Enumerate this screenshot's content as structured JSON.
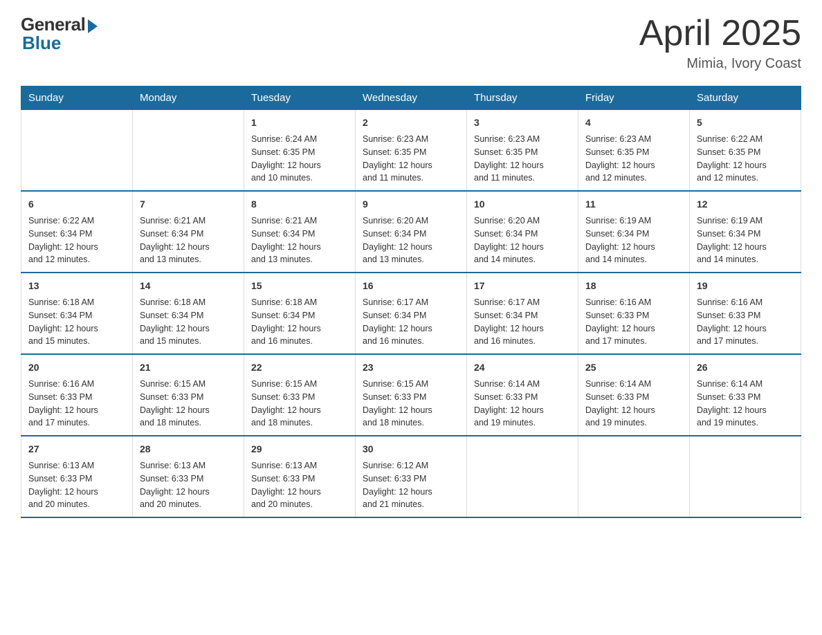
{
  "logo": {
    "general": "General",
    "blue": "Blue"
  },
  "header": {
    "title": "April 2025",
    "subtitle": "Mimia, Ivory Coast"
  },
  "weekdays": [
    "Sunday",
    "Monday",
    "Tuesday",
    "Wednesday",
    "Thursday",
    "Friday",
    "Saturday"
  ],
  "weeks": [
    [
      {
        "day": "",
        "info": ""
      },
      {
        "day": "",
        "info": ""
      },
      {
        "day": "1",
        "info": "Sunrise: 6:24 AM\nSunset: 6:35 PM\nDaylight: 12 hours\nand 10 minutes."
      },
      {
        "day": "2",
        "info": "Sunrise: 6:23 AM\nSunset: 6:35 PM\nDaylight: 12 hours\nand 11 minutes."
      },
      {
        "day": "3",
        "info": "Sunrise: 6:23 AM\nSunset: 6:35 PM\nDaylight: 12 hours\nand 11 minutes."
      },
      {
        "day": "4",
        "info": "Sunrise: 6:23 AM\nSunset: 6:35 PM\nDaylight: 12 hours\nand 12 minutes."
      },
      {
        "day": "5",
        "info": "Sunrise: 6:22 AM\nSunset: 6:35 PM\nDaylight: 12 hours\nand 12 minutes."
      }
    ],
    [
      {
        "day": "6",
        "info": "Sunrise: 6:22 AM\nSunset: 6:34 PM\nDaylight: 12 hours\nand 12 minutes."
      },
      {
        "day": "7",
        "info": "Sunrise: 6:21 AM\nSunset: 6:34 PM\nDaylight: 12 hours\nand 13 minutes."
      },
      {
        "day": "8",
        "info": "Sunrise: 6:21 AM\nSunset: 6:34 PM\nDaylight: 12 hours\nand 13 minutes."
      },
      {
        "day": "9",
        "info": "Sunrise: 6:20 AM\nSunset: 6:34 PM\nDaylight: 12 hours\nand 13 minutes."
      },
      {
        "day": "10",
        "info": "Sunrise: 6:20 AM\nSunset: 6:34 PM\nDaylight: 12 hours\nand 14 minutes."
      },
      {
        "day": "11",
        "info": "Sunrise: 6:19 AM\nSunset: 6:34 PM\nDaylight: 12 hours\nand 14 minutes."
      },
      {
        "day": "12",
        "info": "Sunrise: 6:19 AM\nSunset: 6:34 PM\nDaylight: 12 hours\nand 14 minutes."
      }
    ],
    [
      {
        "day": "13",
        "info": "Sunrise: 6:18 AM\nSunset: 6:34 PM\nDaylight: 12 hours\nand 15 minutes."
      },
      {
        "day": "14",
        "info": "Sunrise: 6:18 AM\nSunset: 6:34 PM\nDaylight: 12 hours\nand 15 minutes."
      },
      {
        "day": "15",
        "info": "Sunrise: 6:18 AM\nSunset: 6:34 PM\nDaylight: 12 hours\nand 16 minutes."
      },
      {
        "day": "16",
        "info": "Sunrise: 6:17 AM\nSunset: 6:34 PM\nDaylight: 12 hours\nand 16 minutes."
      },
      {
        "day": "17",
        "info": "Sunrise: 6:17 AM\nSunset: 6:34 PM\nDaylight: 12 hours\nand 16 minutes."
      },
      {
        "day": "18",
        "info": "Sunrise: 6:16 AM\nSunset: 6:33 PM\nDaylight: 12 hours\nand 17 minutes."
      },
      {
        "day": "19",
        "info": "Sunrise: 6:16 AM\nSunset: 6:33 PM\nDaylight: 12 hours\nand 17 minutes."
      }
    ],
    [
      {
        "day": "20",
        "info": "Sunrise: 6:16 AM\nSunset: 6:33 PM\nDaylight: 12 hours\nand 17 minutes."
      },
      {
        "day": "21",
        "info": "Sunrise: 6:15 AM\nSunset: 6:33 PM\nDaylight: 12 hours\nand 18 minutes."
      },
      {
        "day": "22",
        "info": "Sunrise: 6:15 AM\nSunset: 6:33 PM\nDaylight: 12 hours\nand 18 minutes."
      },
      {
        "day": "23",
        "info": "Sunrise: 6:15 AM\nSunset: 6:33 PM\nDaylight: 12 hours\nand 18 minutes."
      },
      {
        "day": "24",
        "info": "Sunrise: 6:14 AM\nSunset: 6:33 PM\nDaylight: 12 hours\nand 19 minutes."
      },
      {
        "day": "25",
        "info": "Sunrise: 6:14 AM\nSunset: 6:33 PM\nDaylight: 12 hours\nand 19 minutes."
      },
      {
        "day": "26",
        "info": "Sunrise: 6:14 AM\nSunset: 6:33 PM\nDaylight: 12 hours\nand 19 minutes."
      }
    ],
    [
      {
        "day": "27",
        "info": "Sunrise: 6:13 AM\nSunset: 6:33 PM\nDaylight: 12 hours\nand 20 minutes."
      },
      {
        "day": "28",
        "info": "Sunrise: 6:13 AM\nSunset: 6:33 PM\nDaylight: 12 hours\nand 20 minutes."
      },
      {
        "day": "29",
        "info": "Sunrise: 6:13 AM\nSunset: 6:33 PM\nDaylight: 12 hours\nand 20 minutes."
      },
      {
        "day": "30",
        "info": "Sunrise: 6:12 AM\nSunset: 6:33 PM\nDaylight: 12 hours\nand 21 minutes."
      },
      {
        "day": "",
        "info": ""
      },
      {
        "day": "",
        "info": ""
      },
      {
        "day": "",
        "info": ""
      }
    ]
  ]
}
